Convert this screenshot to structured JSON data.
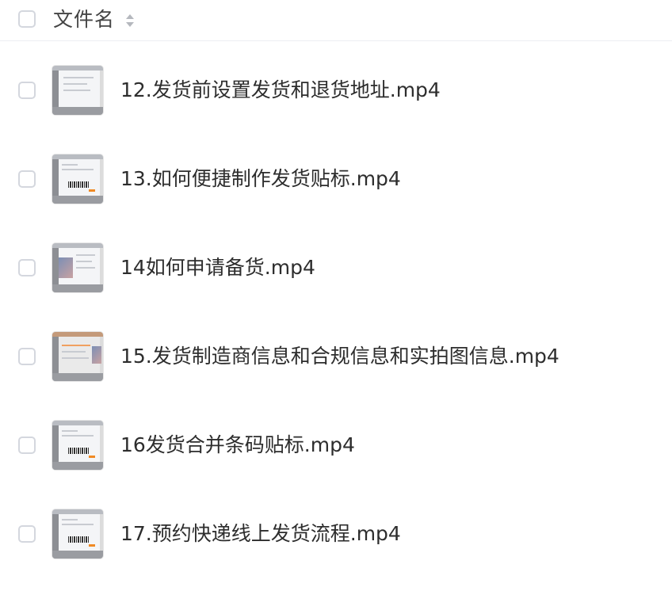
{
  "header": {
    "column_title": "文件名",
    "sort_icon": "sort-updown-icon"
  },
  "files": [
    {
      "name": "12.发货前设置发货和退货地址.mp4",
      "thumb": "video-thumbnail-icon"
    },
    {
      "name": "13.如何便捷制作发货贴标.mp4",
      "thumb": "video-thumbnail-icon"
    },
    {
      "name": "14如何申请备货.mp4",
      "thumb": "video-thumbnail-icon"
    },
    {
      "name": "15.发货制造商信息和合规信息和实拍图信息.mp4",
      "thumb": "video-thumbnail-icon"
    },
    {
      "name": "16发货合并条码贴标.mp4",
      "thumb": "video-thumbnail-icon"
    },
    {
      "name": "17.预约快递线上发货流程.mp4",
      "thumb": "video-thumbnail-icon"
    }
  ]
}
